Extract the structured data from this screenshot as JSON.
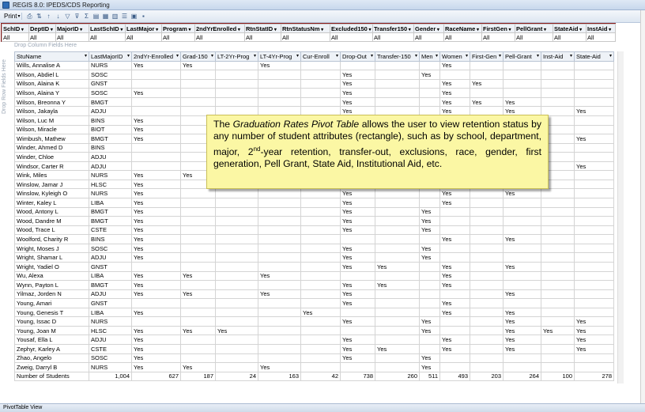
{
  "window": {
    "title": "REGIS 8.0: IPEDS/CDS Reporting"
  },
  "toolbar": {
    "print_label": "Print",
    "icons": [
      "print-icon",
      "arrows-icon",
      "sort-asc-icon",
      "sort-desc-icon",
      "filter-icon",
      "autofilter-icon",
      "subtotal-icon",
      "fields-icon",
      "table-icon",
      "chart-icon",
      "field-list-icon",
      "export-icon",
      "properties-icon"
    ]
  },
  "filters": {
    "headers": [
      "SchID",
      "DeptID",
      "MajorID",
      "LastSchID",
      "LastMajor",
      "Program",
      "2ndYrEnrolled",
      "RtnStatID",
      "RtnStatusNm",
      "Excluded150",
      "Transfer150",
      "Gender",
      "RaceName",
      "FirstGen",
      "PellGrant",
      "StateAid",
      "InstAid"
    ],
    "value": "All"
  },
  "drop_zones": {
    "column": "Drop Column Fields Here",
    "row": "Drop Row Fields Here"
  },
  "table": {
    "row_header": "StuName",
    "columns": [
      "LastMajorID",
      "2ndYr-Enrolled",
      "Grad-150",
      "LT-2Yr-Prog",
      "LT-4Yr-Prog",
      "Cur-Enroll",
      "Drop-Out",
      "Transfer-150",
      "Men",
      "Women",
      "First-Gen",
      "Pell-Grant",
      "Inst-Aid",
      "State-Aid"
    ],
    "rows": [
      [
        "Wills, Annalise A",
        "NURS",
        "Yes",
        "Yes",
        "",
        "Yes",
        "",
        "",
        "",
        "",
        "Yes",
        "",
        "",
        "",
        ""
      ],
      [
        "Wilson, Abdiel L",
        "SOSC",
        "",
        "",
        "",
        "",
        "",
        "Yes",
        "",
        "Yes",
        "",
        "",
        "",
        "",
        ""
      ],
      [
        "Wilson, Alaina K",
        "GNST",
        "",
        "",
        "",
        "",
        "",
        "Yes",
        "",
        "",
        "Yes",
        "Yes",
        "",
        "",
        ""
      ],
      [
        "Wilson, Alaina Y",
        "SOSC",
        "Yes",
        "",
        "",
        "",
        "",
        "Yes",
        "",
        "",
        "Yes",
        "",
        "",
        "",
        ""
      ],
      [
        "Wilson, Breonna Y",
        "BMGT",
        "",
        "",
        "",
        "",
        "",
        "Yes",
        "",
        "",
        "Yes",
        "Yes",
        "Yes",
        "",
        ""
      ],
      [
        "Wilson, Jakayla",
        "ADJU",
        "",
        "",
        "",
        "",
        "",
        "Yes",
        "",
        "",
        "Yes",
        "",
        "Yes",
        "",
        "Yes"
      ],
      [
        "Wilson, Luc M",
        "BINS",
        "Yes",
        "",
        "",
        "",
        "",
        "",
        "",
        "",
        "",
        "",
        "",
        "",
        ""
      ],
      [
        "Wilson, Miracle",
        "BIOT",
        "Yes",
        "",
        "",
        "",
        "",
        "",
        "",
        "",
        "",
        "",
        "",
        "",
        ""
      ],
      [
        "Wimbush, Mathew",
        "BMGT",
        "Yes",
        "",
        "",
        "",
        "",
        "",
        "",
        "",
        "",
        "",
        "",
        "",
        "Yes"
      ],
      [
        "Winder, Ahmed D",
        "BINS",
        "",
        "",
        "",
        "",
        "",
        "",
        "",
        "",
        "",
        "",
        "",
        "",
        ""
      ],
      [
        "Winder, Chloe",
        "ADJU",
        "",
        "",
        "",
        "",
        "",
        "",
        "",
        "",
        "",
        "",
        "",
        "",
        ""
      ],
      [
        "Windsor, Carter R",
        "ADJU",
        "",
        "",
        "",
        "",
        "",
        "",
        "",
        "",
        "",
        "",
        "",
        "",
        "Yes"
      ],
      [
        "Wink, Miles",
        "NURS",
        "Yes",
        "Yes",
        "",
        "",
        "",
        "",
        "",
        "",
        "",
        "",
        "",
        "",
        ""
      ],
      [
        "Winslow, Jamar J",
        "HLSC",
        "Yes",
        "",
        "",
        "",
        "",
        "",
        "",
        "",
        "",
        "",
        "",
        "",
        ""
      ],
      [
        "Winslow, Kyleigh O",
        "NURS",
        "Yes",
        "",
        "",
        "",
        "",
        "Yes",
        "",
        "",
        "Yes",
        "",
        "Yes",
        "",
        ""
      ],
      [
        "Winter, Kaley L",
        "LIBA",
        "Yes",
        "",
        "",
        "",
        "",
        "Yes",
        "",
        "",
        "Yes",
        "",
        "",
        "",
        ""
      ],
      [
        "Wood, Antony L",
        "BMGT",
        "Yes",
        "",
        "",
        "",
        "",
        "Yes",
        "",
        "Yes",
        "",
        "",
        "",
        "",
        ""
      ],
      [
        "Wood, Dandre M",
        "BMGT",
        "Yes",
        "",
        "",
        "",
        "",
        "Yes",
        "",
        "Yes",
        "",
        "",
        "",
        "",
        ""
      ],
      [
        "Wood, Trace L",
        "CSTE",
        "Yes",
        "",
        "",
        "",
        "",
        "Yes",
        "",
        "Yes",
        "",
        "",
        "",
        "",
        ""
      ],
      [
        "Woolford, Charity R",
        "BINS",
        "Yes",
        "",
        "",
        "",
        "",
        "",
        "",
        "",
        "Yes",
        "",
        "Yes",
        "",
        ""
      ],
      [
        "Wright, Moses J",
        "SOSC",
        "Yes",
        "",
        "",
        "",
        "",
        "Yes",
        "",
        "Yes",
        "",
        "",
        "",
        "",
        ""
      ],
      [
        "Wright, Shamar L",
        "ADJU",
        "Yes",
        "",
        "",
        "",
        "",
        "Yes",
        "",
        "Yes",
        "",
        "",
        "",
        "",
        ""
      ],
      [
        "Wright, Yadiel O",
        "GNST",
        "",
        "",
        "",
        "",
        "",
        "Yes",
        "Yes",
        "",
        "Yes",
        "",
        "Yes",
        "",
        ""
      ],
      [
        "Wu, Alexa",
        "LIBA",
        "Yes",
        "Yes",
        "",
        "Yes",
        "",
        "",
        "",
        "",
        "Yes",
        "",
        "",
        "",
        ""
      ],
      [
        "Wynn, Payton L",
        "BMGT",
        "Yes",
        "",
        "",
        "",
        "",
        "Yes",
        "Yes",
        "",
        "Yes",
        "",
        "",
        "",
        ""
      ],
      [
        "Yilmaz, Jorden N",
        "ADJU",
        "Yes",
        "Yes",
        "",
        "Yes",
        "",
        "Yes",
        "",
        "",
        "",
        "",
        "Yes",
        "",
        ""
      ],
      [
        "Young, Amari",
        "GNST",
        "",
        "",
        "",
        "",
        "",
        "Yes",
        "",
        "",
        "Yes",
        "",
        "",
        "",
        ""
      ],
      [
        "Young, Genesis T",
        "LIBA",
        "Yes",
        "",
        "",
        "",
        "Yes",
        "",
        "",
        "",
        "Yes",
        "",
        "Yes",
        "",
        ""
      ],
      [
        "Young, Issac D",
        "NURS",
        "",
        "",
        "",
        "",
        "",
        "Yes",
        "",
        "Yes",
        "",
        "",
        "Yes",
        "",
        "Yes"
      ],
      [
        "Young, Joan M",
        "HLSC",
        "Yes",
        "Yes",
        "Yes",
        "",
        "",
        "",
        "",
        "Yes",
        "",
        "",
        "Yes",
        "Yes",
        "Yes"
      ],
      [
        "Yousaf, Ella L",
        "ADJU",
        "Yes",
        "",
        "",
        "",
        "",
        "Yes",
        "",
        "",
        "Yes",
        "",
        "Yes",
        "",
        "Yes"
      ],
      [
        "Zephyr, Karley A",
        "CSTE",
        "Yes",
        "",
        "",
        "",
        "",
        "Yes",
        "Yes",
        "",
        "Yes",
        "",
        "Yes",
        "",
        "Yes"
      ],
      [
        "Zhao, Angelo",
        "SOSC",
        "Yes",
        "",
        "",
        "",
        "",
        "Yes",
        "",
        "Yes",
        "",
        "",
        "",
        "",
        ""
      ],
      [
        "Zweig, Darryl B",
        "NURS",
        "Yes",
        "Yes",
        "",
        "Yes",
        "",
        "",
        "",
        "Yes",
        "",
        "",
        "",
        "",
        ""
      ]
    ],
    "total": [
      "Number of Students",
      "1,004",
      "627",
      "187",
      "24",
      "163",
      "42",
      "738",
      "260",
      "511",
      "493",
      "203",
      "264",
      "100",
      "278"
    ]
  },
  "callout": {
    "prefix": "The ",
    "emphasis": "Graduation Rates Pivot Table",
    "part1": " allows the user to view retention status by any number of student attributes (rectangle), such as by school, department, major, 2",
    "sup": "nd",
    "part2": "-year retention, transfer-out, exclusions, race, gender, first generation, Pell Grant, State Aid, Institutional Aid, etc."
  },
  "status_bar": {
    "label": "PivotTable View"
  }
}
